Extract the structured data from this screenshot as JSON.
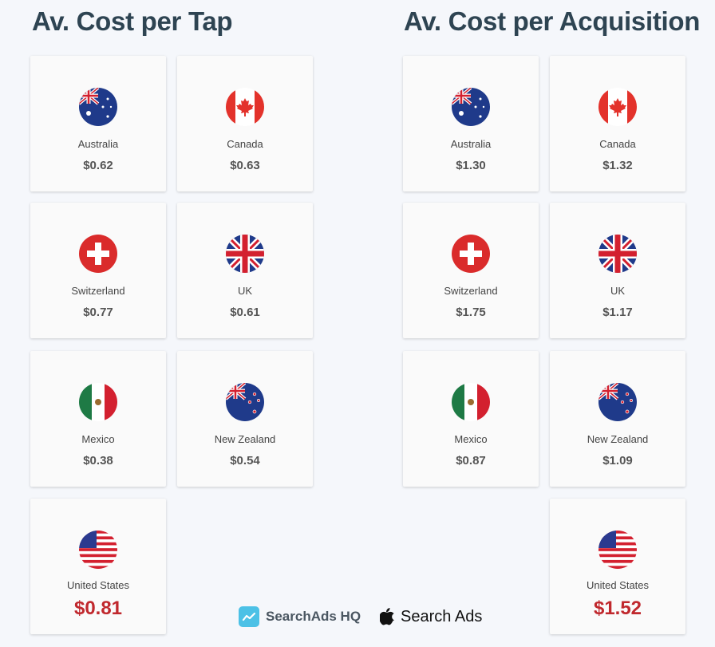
{
  "sections": [
    {
      "title": "Av. Cost per Tap",
      "cards": [
        {
          "country": "Australia",
          "flag": "australia-flag",
          "value": "$0.62"
        },
        {
          "country": "Canada",
          "flag": "canada-flag",
          "value": "$0.63"
        },
        {
          "country": "Switzerland",
          "flag": "switzerland-flag",
          "value": "$0.77"
        },
        {
          "country": "UK",
          "flag": "uk-flag",
          "value": "$0.61"
        },
        {
          "country": "Mexico",
          "flag": "mexico-flag",
          "value": "$0.38"
        },
        {
          "country": "New Zealand",
          "flag": "new-zealand-flag",
          "value": "$0.54"
        },
        {
          "country": "United States",
          "flag": "usa-flag",
          "value": "$0.81",
          "highlight": true
        }
      ]
    },
    {
      "title": "Av. Cost per Acquisition",
      "cards": [
        {
          "country": "Australia",
          "flag": "australia-flag",
          "value": "$1.30"
        },
        {
          "country": "Canada",
          "flag": "canada-flag",
          "value": "$1.32"
        },
        {
          "country": "Switzerland",
          "flag": "switzerland-flag",
          "value": "$1.75"
        },
        {
          "country": "UK",
          "flag": "uk-flag",
          "value": "$1.17"
        },
        {
          "country": "Mexico",
          "flag": "mexico-flag",
          "value": "$0.87"
        },
        {
          "country": "New Zealand",
          "flag": "new-zealand-flag",
          "value": "$1.09"
        },
        {
          "country": "United States",
          "flag": "usa-flag",
          "value": "$1.52",
          "highlight": true
        }
      ]
    }
  ],
  "footer": {
    "brand1": "SearchAds HQ",
    "brand2": "Search Ads"
  },
  "colors": {
    "title": "#2e4452",
    "highlight_value": "#c0282d",
    "hq_logo": "#4cc1e6"
  }
}
